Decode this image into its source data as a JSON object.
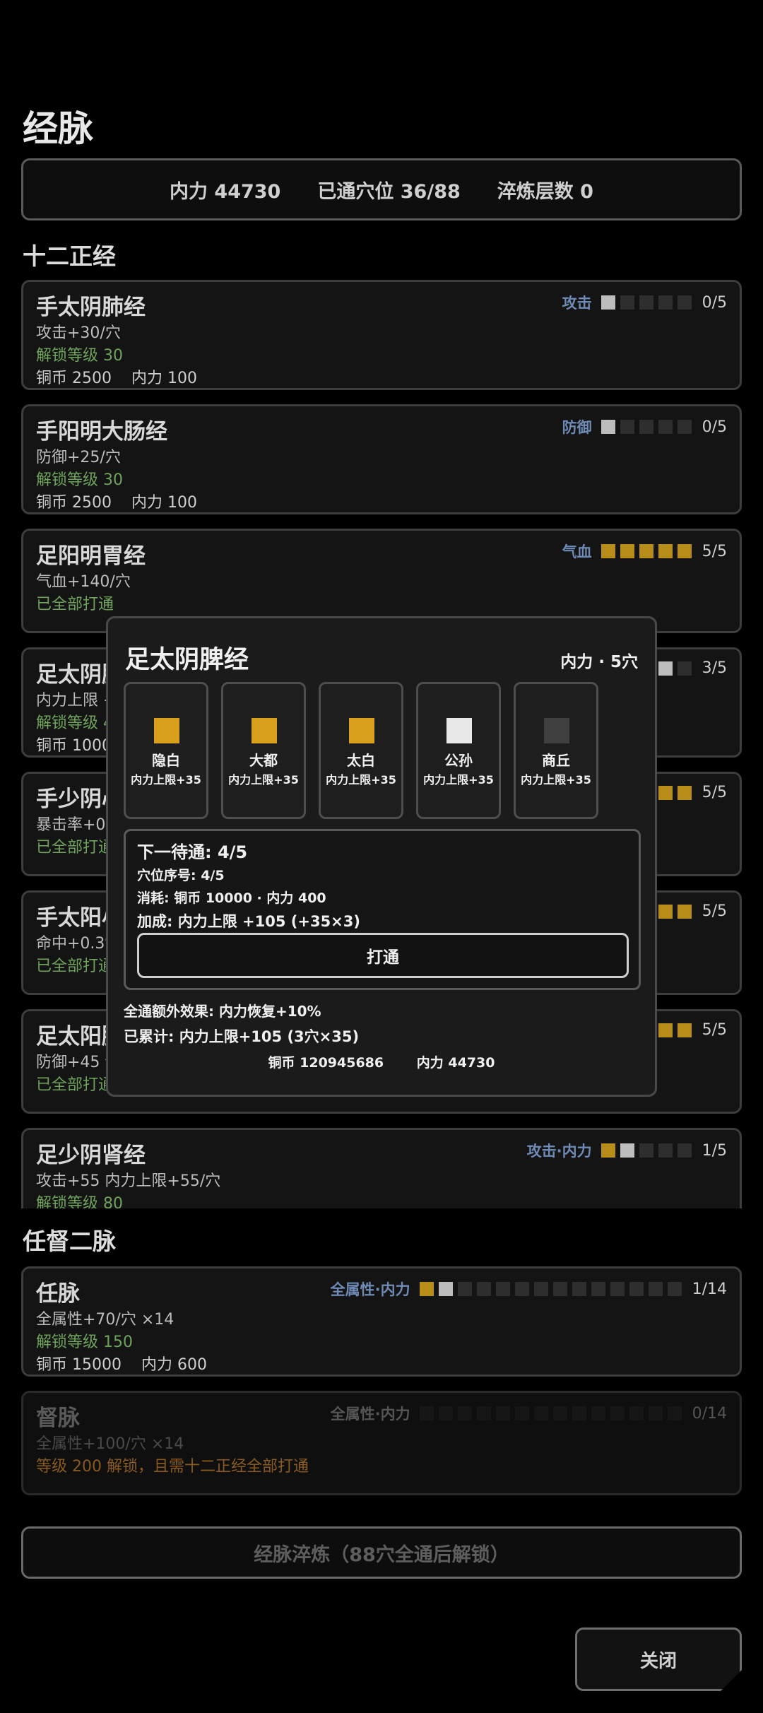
{
  "title": "经脉",
  "stats": {
    "neili": "内力 44730",
    "opened": "已通穴位 36/88",
    "refine": "淬炼层数 0"
  },
  "section_main": "十二正经",
  "meridians": [
    {
      "name": "手太阴肺经",
      "tag": "攻击",
      "pips": [
        "white",
        "off",
        "off",
        "off",
        "off"
      ],
      "count": "0/5",
      "effect": "攻击+30/穴",
      "unlock": "解锁等级 30",
      "cost_coin": "铜币 2500",
      "cost_neili": "内力 100"
    },
    {
      "name": "手阳明大肠经",
      "tag": "防御",
      "pips": [
        "white",
        "off",
        "off",
        "off",
        "off"
      ],
      "count": "0/5",
      "effect": "防御+25/穴",
      "unlock": "解锁等级 30",
      "cost_coin": "铜币 2500",
      "cost_neili": "内力 100"
    },
    {
      "name": "足阳明胃经",
      "tag": "气血",
      "pips": [
        "gold",
        "gold",
        "gold",
        "gold",
        "gold"
      ],
      "count": "5/5",
      "effect": "气血+140/穴",
      "unlock": "已全部打通"
    },
    {
      "name": "足太阴脾经",
      "partial_name": "足太阴脾",
      "count": "3/5",
      "effect_partial": "内力上限 +",
      "unlock_partial": "解锁等级 4",
      "cost_partial": "铜币 10000"
    },
    {
      "partial_name": "手少阴心",
      "count": "5/5",
      "effect_partial": "暴击率+0.3",
      "unlock_partial": "已全部打通"
    },
    {
      "partial_name": "手太阳小",
      "count": "5/5",
      "effect_partial": "命中+0.3%",
      "unlock_partial": "已全部打通"
    },
    {
      "partial_name": "足太阳膀",
      "count": "5/5",
      "effect_partial": "防御+45 气",
      "unlock_partial": "已全部打通"
    },
    {
      "name": "足少阴肾经",
      "tag": "攻击·内力",
      "pips": [
        "gold",
        "white",
        "off",
        "off",
        "off"
      ],
      "count": "1/5",
      "effect": "攻击+55 内力上限+55/穴",
      "unlock": "解锁等级 80"
    }
  ],
  "section_extra": "任督二脉",
  "ren": {
    "name": "任脉",
    "tag": "全属性·内力",
    "count": "1/14",
    "effect": "全属性+70/穴 ×14",
    "unlock": "解锁等级 150",
    "cost_coin": "铜币 15000",
    "cost_neili": "内力 600"
  },
  "du": {
    "name": "督脉",
    "tag": "全属性·内力",
    "count": "0/14",
    "effect": "全属性+100/穴 ×14",
    "unlock": "等级 200 解锁，且需十二正经全部打通"
  },
  "refine_button": "经脉淬炼（88穴全通后解锁）",
  "close_button": "关闭",
  "modal": {
    "title": "足太阴脾经",
    "cost": "内力 · 5穴",
    "acupoints": [
      {
        "name": "隐白",
        "bonus": "内力上限+35",
        "state": "gold"
      },
      {
        "name": "大都",
        "bonus": "内力上限+35",
        "state": "gold"
      },
      {
        "name": "太白",
        "bonus": "内力上限+35",
        "state": "gold"
      },
      {
        "name": "公孙",
        "bonus": "内力上限+35",
        "state": "white"
      },
      {
        "name": "商丘",
        "bonus": "内力上限+35",
        "state": "gray"
      }
    ],
    "next": "下一待通: 4/5",
    "index": "穴位序号: 4/5",
    "consume": "消耗: 铜币 10000 · 内力 400",
    "bonus": "加成: 内力上限 +105 (+35×3)",
    "open_button": "打通",
    "full_effect": "全通额外效果: 内力恢复+10%",
    "accumulated": "已累计: 内力上限+105 (3穴×35)",
    "wallet_coin": "铜币 120945686",
    "wallet_neili": "内力 44730"
  },
  "colors": {
    "gold": "#b88c18",
    "tag_blue": "#6f8bb5",
    "unlock_green": "#6fa35b",
    "locked_orange": "#8a5a1e"
  }
}
